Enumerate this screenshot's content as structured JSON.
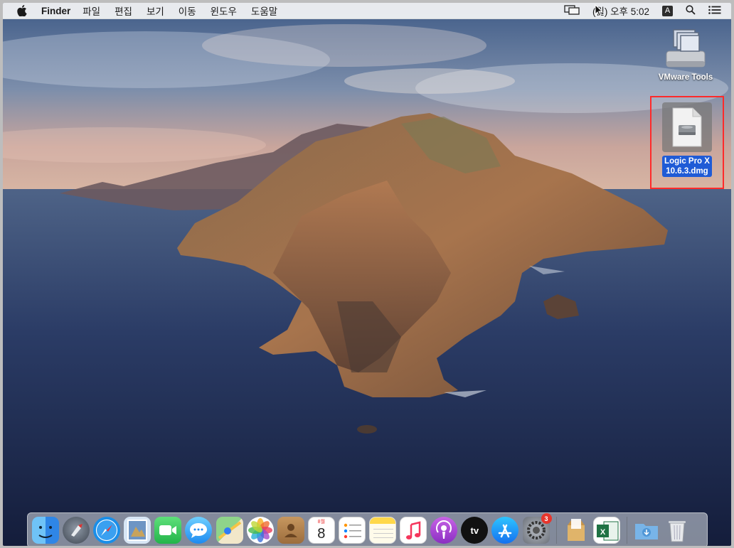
{
  "menubar": {
    "app_name": "Finder",
    "menus": [
      "파일",
      "편집",
      "보기",
      "이동",
      "윈도우",
      "도움말"
    ],
    "clock": "(월) 오후 5:02",
    "input_source": "A"
  },
  "desktop": {
    "vmware_label": "VMware Tools",
    "dmg_label_line1": "Logic Pro X",
    "dmg_label_line2": "10.6.3.dmg"
  },
  "dock": {
    "calendar_month": "8월",
    "calendar_day": "8",
    "tv_label": "tv",
    "system_preferences_badge": "3"
  },
  "colors": {
    "selection_highlight": "#1f5bd6",
    "annotation_box": "#ff2a2a"
  }
}
